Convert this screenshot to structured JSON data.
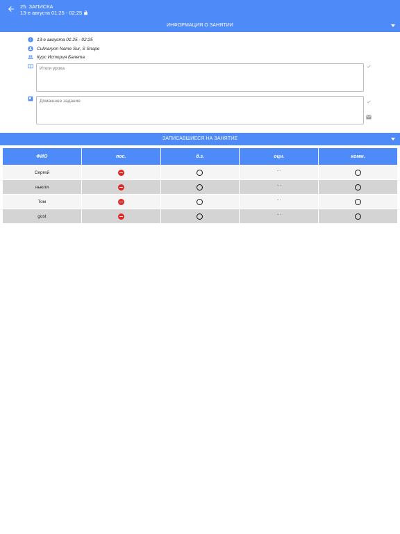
{
  "header": {
    "title": "25. ЗАПИСКА",
    "subtitle": "13-е августа 01:25 - 02:25"
  },
  "info_section": {
    "label": "ИНФОРМАЦИЯ О ЗАНЯТИИ",
    "date": "13-е августа 01:25 - 02:25",
    "teacher": "Culinaryon Name Sur, S Snape",
    "course": "Курс История Балета",
    "summary_placeholder": "Итоги урока",
    "homework_placeholder": "Домашнее задание"
  },
  "enrolled_section": {
    "label": "ЗАПИСАВШИЕСЯ НА ЗАНЯТИЕ"
  },
  "table": {
    "headers": [
      "ФИО",
      "пос.",
      "д.з.",
      "оцн.",
      "комм."
    ],
    "rows": [
      {
        "name": "Сергей",
        "grade": "···"
      },
      {
        "name": "ньюли",
        "grade": "···"
      },
      {
        "name": "Том",
        "grade": "···"
      },
      {
        "name": "gost",
        "grade": "···"
      }
    ]
  },
  "colors": {
    "primary": "#4e8af8",
    "absent": "#e32626"
  }
}
